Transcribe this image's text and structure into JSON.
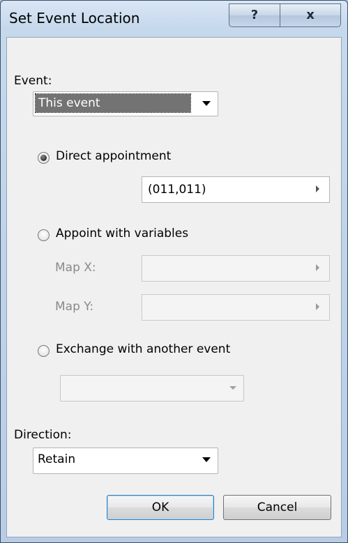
{
  "window": {
    "title": "Set Event Location",
    "help_glyph": "?",
    "close_glyph": "x"
  },
  "event": {
    "label": "Event:",
    "selected": "This event"
  },
  "direct": {
    "label": "Direct appointment",
    "checked": true,
    "value": "(011,011)"
  },
  "variables": {
    "label": "Appoint with variables",
    "checked": false,
    "map_x_label": "Map X:",
    "map_y_label": "Map Y:",
    "map_x_value": "",
    "map_y_value": ""
  },
  "exchange": {
    "label": "Exchange with another event",
    "checked": false,
    "selected": ""
  },
  "direction": {
    "label": "Direction:",
    "selected": "Retain"
  },
  "buttons": {
    "ok": "OK",
    "cancel": "Cancel"
  },
  "icons": {
    "dropdown": "chevron-down-icon",
    "field_picker": "triangle-right-icon",
    "help": "help-icon",
    "close": "close-icon"
  }
}
